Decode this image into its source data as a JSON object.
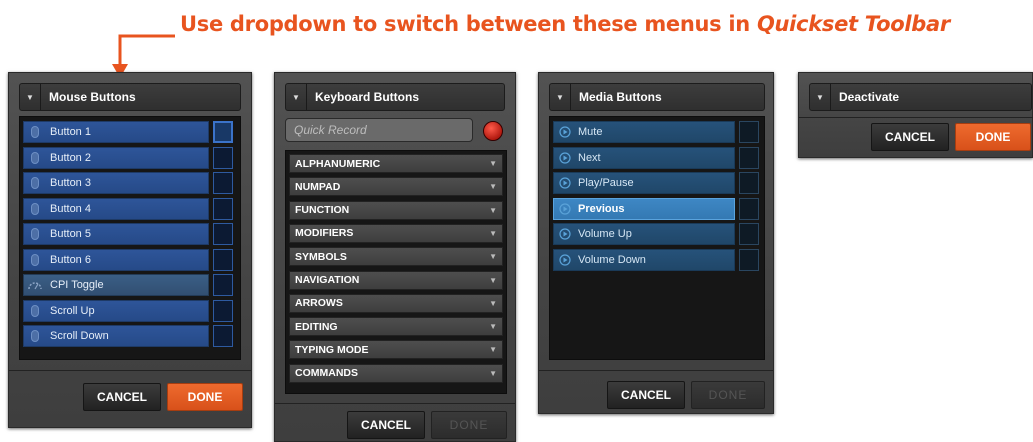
{
  "annotation": {
    "text_part1": "Use dropdown to switch between these menus in ",
    "text_part2": "Quickset Toolbar",
    "color": "#e8541f"
  },
  "mouse_panel": {
    "dropdown": "Mouse Buttons",
    "items": [
      {
        "label": "Button 1",
        "icon": "mouse-icon"
      },
      {
        "label": "Button 2",
        "icon": "mouse-icon"
      },
      {
        "label": "Button 3",
        "icon": "mouse-icon"
      },
      {
        "label": "Button 4",
        "icon": "mouse-icon"
      },
      {
        "label": "Button 5",
        "icon": "mouse-icon"
      },
      {
        "label": "Button 6",
        "icon": "mouse-icon"
      },
      {
        "label": "CPI Toggle",
        "icon": "gauge-icon"
      },
      {
        "label": "Scroll Up",
        "icon": "mouse-icon"
      },
      {
        "label": "Scroll Down",
        "icon": "mouse-icon"
      }
    ],
    "cancel": "CANCEL",
    "done": "DONE"
  },
  "keyboard_panel": {
    "dropdown": "Keyboard Buttons",
    "quick_record_placeholder": "Quick Record",
    "categories": [
      "ALPHANUMERIC",
      "NUMPAD",
      "FUNCTION",
      "MODIFIERS",
      "SYMBOLS",
      "NAVIGATION",
      "ARROWS",
      "EDITING",
      "TYPING MODE",
      "COMMANDS"
    ],
    "cancel": "CANCEL",
    "done": "DONE"
  },
  "media_panel": {
    "dropdown": "Media Buttons",
    "items": [
      {
        "label": "Mute",
        "icon": "play-circle-icon"
      },
      {
        "label": "Next",
        "icon": "play-circle-icon"
      },
      {
        "label": "Play/Pause",
        "icon": "play-circle-icon"
      },
      {
        "label": "Previous",
        "icon": "play-circle-icon"
      },
      {
        "label": "Volume Up",
        "icon": "play-circle-icon"
      },
      {
        "label": "Volume Down",
        "icon": "play-circle-icon"
      }
    ],
    "selected": "Previous",
    "cancel": "CANCEL",
    "done": "DONE"
  },
  "deactivate_panel": {
    "dropdown": "Deactivate",
    "cancel": "CANCEL",
    "done": "DONE"
  },
  "colors": {
    "accent_orange": "#e8541f",
    "mouse_item_blue": "#2e5599",
    "media_item_blue": "#26527a",
    "media_selected_blue": "#3e87c4"
  }
}
